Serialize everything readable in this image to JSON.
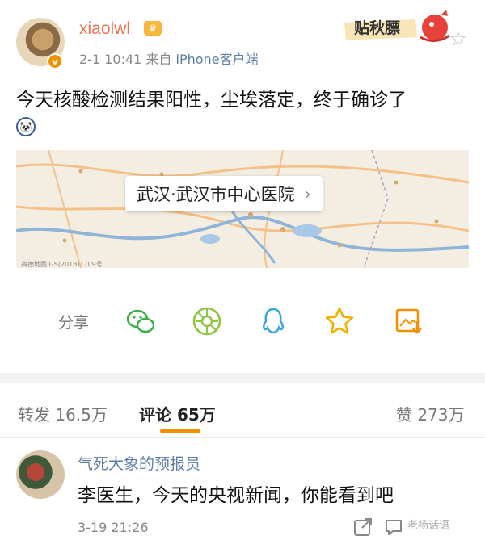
{
  "header": {
    "username": "xiaolwl",
    "time": "2-1 10:41",
    "source_prefix": "来自",
    "source": "iPhone客户端",
    "sticker_text": "贴秋膘"
  },
  "post": {
    "text": "今天核酸检测结果阳性，尘埃落定，终于确诊了"
  },
  "location": {
    "label": "武汉·武汉市中心医院",
    "credit": "高德地图 GS(2018)1709号"
  },
  "share": {
    "label": "分享",
    "icons": [
      "wechat-icon",
      "moments-icon",
      "qq-icon",
      "qzone-star-icon",
      "save-image-icon"
    ]
  },
  "tabs": {
    "repost": "转发 16.5万",
    "comment": "评论 65万",
    "like": "赞 273万"
  },
  "comment": {
    "user": "气死大象的预报员",
    "text": "李医生，今天的央视新闻，你能看到吧",
    "time": "3-19 21:26",
    "watermark": "老杨话语"
  },
  "colors": {
    "accent": "#f29100",
    "username": "#eb7350",
    "link": "#5b7fa8"
  }
}
